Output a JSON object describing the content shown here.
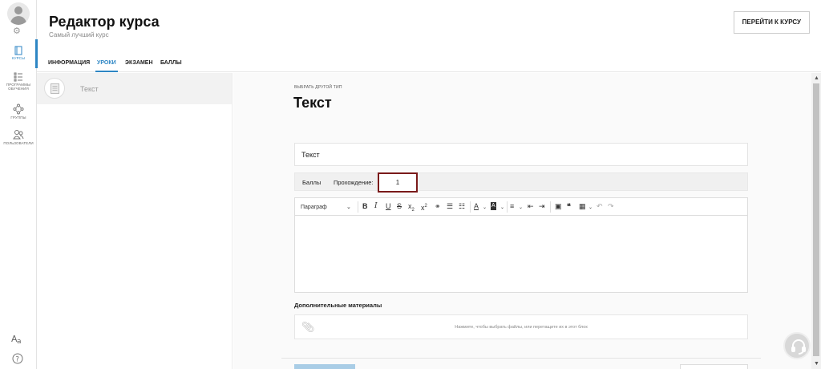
{
  "header": {
    "title": "Редактор курса",
    "subtitle": "Самый лучший курс",
    "goto_button": "ПЕРЕЙТИ К КУРСУ"
  },
  "sidebar": {
    "items": [
      {
        "label": "КУРСЫ",
        "icon": "book-icon",
        "active": true
      },
      {
        "label": "ПРОГРАММЫ ОБУЧЕНИЯ",
        "icon": "list-icon",
        "active": false
      },
      {
        "label": "ГРУППЫ",
        "icon": "group-icon",
        "active": false
      },
      {
        "label": "ПОЛЬЗОВАТЕЛИ",
        "icon": "users-icon",
        "active": false
      }
    ]
  },
  "tabs": [
    "ИНФОРМАЦИЯ",
    "УРОКИ",
    "ЭКЗАМЕН",
    "БАЛЛЫ"
  ],
  "active_tab": "УРОКИ",
  "lessons": [
    {
      "label": "Текст",
      "icon": "document-icon"
    }
  ],
  "editor": {
    "choose_type": "ВЫБРАТЬ ДРУГОЙ ТИП",
    "block_title": "Текст",
    "name_value": "Текст",
    "points_label": "Баллы",
    "pass_label": "Прохождение:",
    "pass_value": "1",
    "paragraph_label": "Параграф",
    "extra_materials_label": "Дополнительные материалы",
    "dropzone_text": "Нажмите, чтобы выбрать файлы, или перетащите их в этот блок"
  },
  "colors": {
    "accent": "#2d86c4",
    "highlight_border": "#7a1a1a"
  }
}
